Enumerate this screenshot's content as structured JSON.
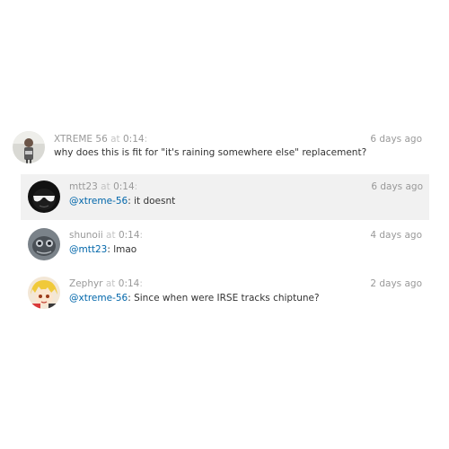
{
  "comments": [
    {
      "user": "XTREME 56",
      "at": "at",
      "time": "0:14",
      "ago": "6 days ago",
      "mention": "",
      "text": "why does this is fit for \"it's raining somewhere else\" replacement?",
      "avatar": "person-photo"
    },
    {
      "user": "mtt23",
      "at": "at",
      "time": "0:14",
      "ago": "6 days ago",
      "mention": "@xtreme-56",
      "text": ": it doesnt",
      "avatar": "sunglasses-face"
    },
    {
      "user": "shunoii",
      "at": "at",
      "time": "0:14",
      "ago": "4 days ago",
      "mention": "@mtt23",
      "text": ": lmao",
      "avatar": "creature-photo"
    },
    {
      "user": "Zephyr",
      "at": "at",
      "time": "0:14",
      "ago": "2 days ago",
      "mention": "@xtreme-56",
      "text": ": Since when were IRSE tracks chiptune?",
      "avatar": "anime-character"
    }
  ],
  "colors": {
    "highlight_bg": "#f1f1f1",
    "mention": "#0066aa",
    "meta": "#999999"
  }
}
